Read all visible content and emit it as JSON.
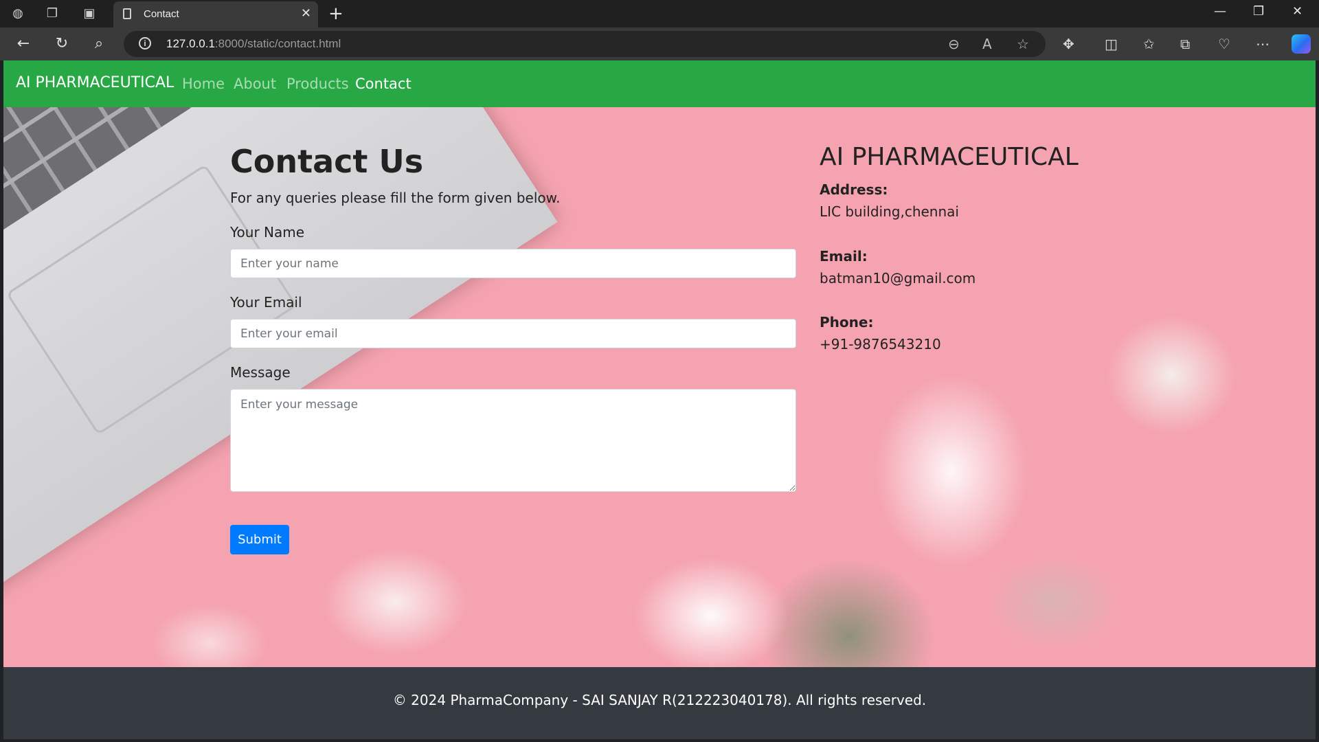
{
  "browser": {
    "tab_title": "Contact",
    "url_host": "127.0.0.1",
    "url_rest": ":8000/static/contact.html",
    "accent": "#2b6cf0"
  },
  "navbar": {
    "brand": "AI PHARMACEUTICAL",
    "links": [
      "Home",
      "About",
      "Products",
      "Contact"
    ],
    "active": "Contact",
    "color": "#28a745"
  },
  "contact_form": {
    "title": "Contact Us",
    "subtitle": "For any queries please fill the form given below.",
    "name_label": "Your Name",
    "name_placeholder": "Enter your name",
    "name_value": "",
    "email_label": "Your Email",
    "email_placeholder": "Enter your email",
    "email_value": "",
    "message_label": "Message",
    "message_placeholder": "Enter your message",
    "message_value": "",
    "submit_label": "Submit",
    "submit_color": "#007bff"
  },
  "company_info": {
    "name": "AI PHARMACEUTICAL",
    "address_label": "Address:",
    "address": "LIC building,chennai",
    "email_label": "Email:",
    "email": "batman10@gmail.com",
    "phone_label": "Phone:",
    "phone": "+91-9876543210"
  },
  "footer": {
    "text": "© 2024 PharmaCompany - SAI SANJAY R(212223040178). All rights reserved.",
    "color": "#343a40"
  },
  "icons": [
    "profile-icon",
    "workspaces-icon",
    "tab-actions-icon",
    "page-icon",
    "close-icon",
    "new-tab-icon",
    "minimize-icon",
    "restore-icon",
    "window-close-icon",
    "back-icon",
    "refresh-icon",
    "search-icon",
    "info-icon",
    "zoom-out-icon",
    "read-aloud-icon",
    "favorite-icon",
    "extensions-icon",
    "split-screen-icon",
    "favorites-icon",
    "collections-icon",
    "browser-essentials-icon",
    "more-icon",
    "copilot-icon"
  ]
}
